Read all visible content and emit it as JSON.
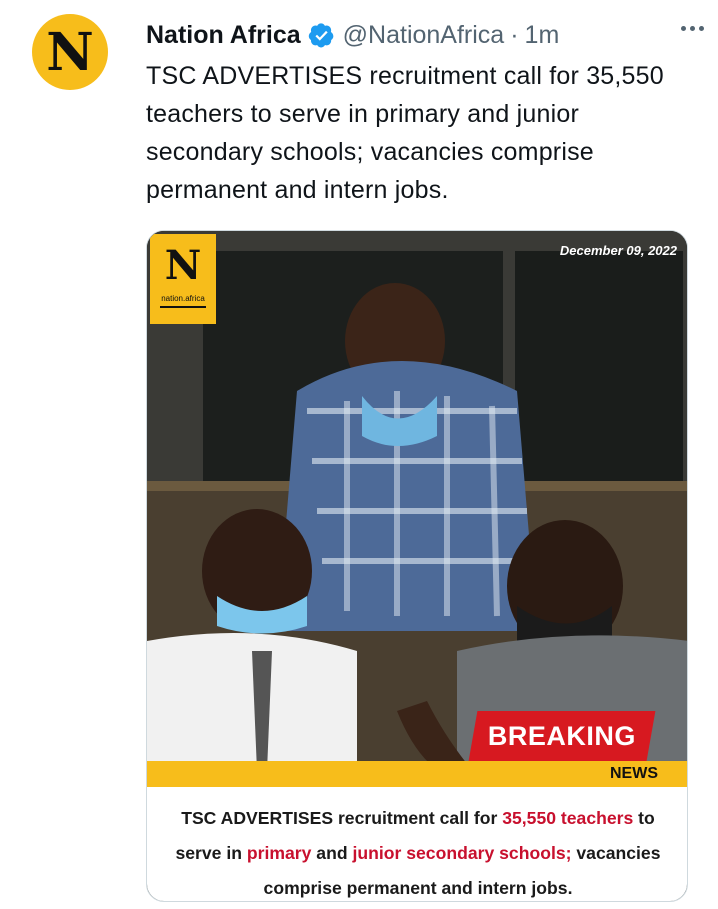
{
  "avatar": {
    "letter": "N"
  },
  "tweet": {
    "name": "Nation Africa",
    "handle": "@NationAfrica",
    "separator": "·",
    "time": "1m",
    "text": "TSC ADVERTISES recruitment call for 35,550 teachers to serve in primary and junior secondary schools; vacancies comprise permanent and intern jobs."
  },
  "media": {
    "logo_letter": "N",
    "logo_site": "nation.africa",
    "date": "December 09, 2022",
    "breaking_label": "BREAKING",
    "news_label": "NEWS",
    "caption": {
      "part1": "TSC ADVERTISES recruitment call for ",
      "highlight1": "35,550 teachers",
      "part2": " to serve in ",
      "highlight2": "primary",
      "part3": " and ",
      "highlight3": "junior secondary schools;",
      "part4": " vacancies comprise permanent and intern jobs."
    }
  },
  "colors": {
    "brand_yellow": "#f7bd1b",
    "breaking_red": "#d71920",
    "verified_blue": "#1d9bf0",
    "secondary_text": "#536471"
  },
  "icons": {
    "verified": "verified-badge-icon",
    "more": "more-dots-icon"
  }
}
